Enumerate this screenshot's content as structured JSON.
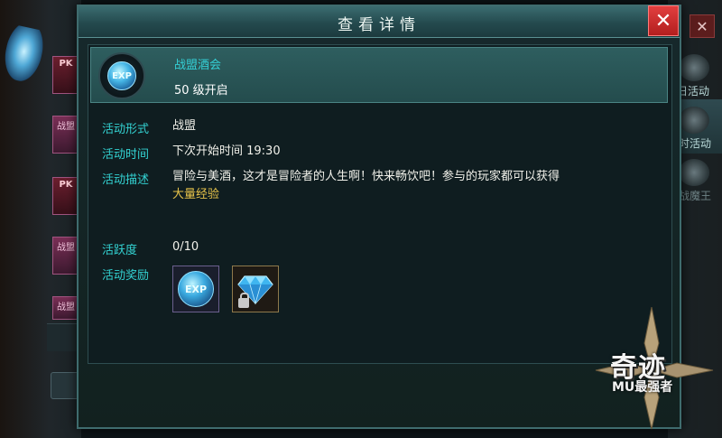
{
  "dialog": {
    "title": "查看详情",
    "close_label": "✕"
  },
  "activity": {
    "name": "战盟酒会",
    "level_text": "50  级开启",
    "icon_text": "EXP"
  },
  "fields": {
    "form_label": "活动形式",
    "form_value": "战盟",
    "time_label": "活动时间",
    "time_value": "下次开始时间 19:30",
    "desc_label": "活动描述",
    "desc_text": "冒险与美酒，这才是冒险者的人生啊！快来畅饮吧！参与的玩家都可以获得",
    "desc_highlight": "大量经验",
    "activity_label": "活跃度",
    "activity_value": "0/10",
    "reward_label": "活动奖励"
  },
  "rewards": [
    {
      "name": "exp-reward",
      "text": "EXP",
      "icon": "exp-orb-icon"
    },
    {
      "name": "diamond-reward",
      "icon": "diamond-icon",
      "locked": true
    }
  ],
  "background": {
    "left_tabs": [
      "PK",
      "战盟",
      "PK",
      "战盟",
      "战盟"
    ],
    "right_items": [
      "日活动",
      "时活动",
      "战魔王"
    ],
    "right_close": "✕"
  },
  "logo": {
    "line1": "奇迹",
    "line2": "MU最强者"
  },
  "colors": {
    "label": "#33d2d2",
    "highlight": "#e7c34a",
    "close": "#d12f2f",
    "header": "#2f5e62"
  }
}
